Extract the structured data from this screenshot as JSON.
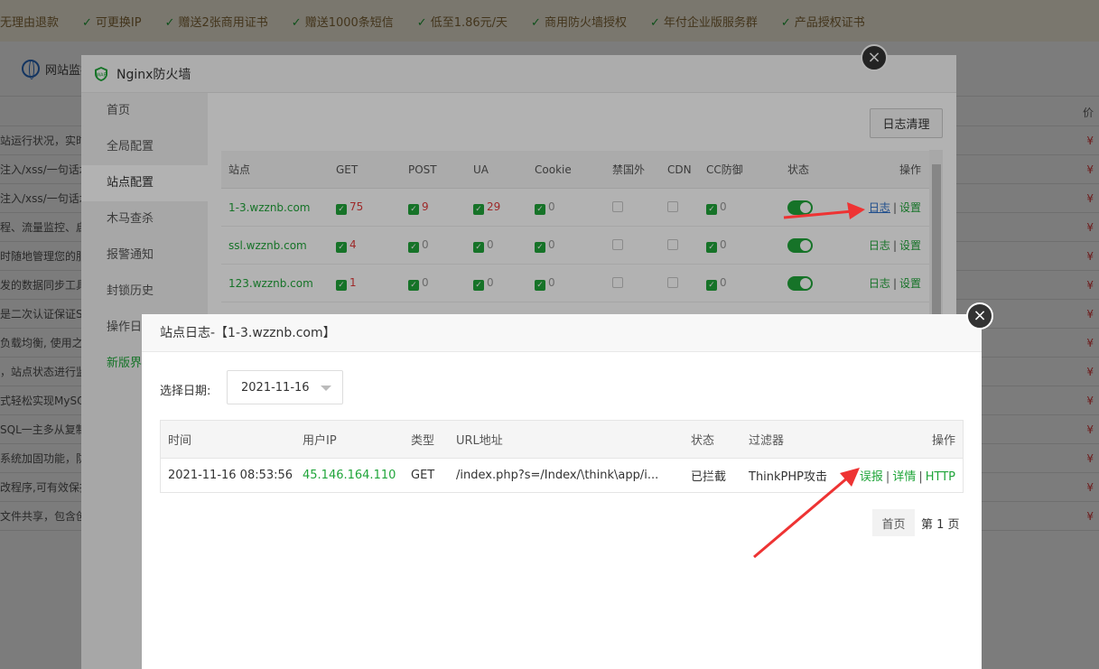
{
  "topbar": {
    "features": [
      "无理由退款",
      "可更换IP",
      "赠送2张商用证书",
      "赠送1000条短信",
      "低至1.86元/天",
      "商用防火墙授权",
      "年付企业版服务群",
      "产品授权证书"
    ]
  },
  "background": {
    "site_bar_label": "网站监控",
    "price_header": "价",
    "rows": [
      "站运行状况，实时",
      "注入/xss/一句话木",
      "注入/xss/一句话木",
      "程、流量监控、启",
      "时随地管理您的服",
      "发的数据同步工具",
      "是二次认证保证SS",
      "负载均衡, 使用之",
      "，站点状态进行监",
      "式轻松实现MySQ",
      "SQL一主多从复制",
      "系统加固功能，防",
      "改程序,可有效保护",
      "文件共享，包含创"
    ],
    "price_symbol": "¥"
  },
  "firewall": {
    "title": "Nginx防火墙",
    "close": "×",
    "menu": [
      "首页",
      "全局配置",
      "站点配置",
      "木马查杀",
      "报警通知",
      "封锁历史",
      "操作日",
      "新版界"
    ],
    "clear_log_button": "日志清理",
    "columns": [
      "站点",
      "GET",
      "POST",
      "UA",
      "Cookie",
      "禁国外",
      "CDN",
      "CC防御",
      "状态",
      "操作"
    ],
    "rows": [
      {
        "site": "1-3.wzznb.com",
        "get": "75",
        "post": "9",
        "ua": "29",
        "cookie": "0",
        "cc": "0",
        "op_log": "日志",
        "op_sep": "|",
        "op_set": "设置"
      },
      {
        "site": "ssl.wzznb.com",
        "get": "4",
        "post": "0",
        "ua": "0",
        "cookie": "0",
        "cc": "0",
        "op_log": "日志",
        "op_sep": "|",
        "op_set": "设置"
      },
      {
        "site": "123.wzznb.com",
        "get": "1",
        "post": "0",
        "ua": "0",
        "cookie": "0",
        "cc": "0",
        "op_log": "日志",
        "op_sep": "|",
        "op_set": "设置"
      }
    ]
  },
  "log_modal": {
    "title": "站点日志-【1-3.wzznb.com】",
    "close": "×",
    "date_label": "选择日期:",
    "date_value": "2021-11-16",
    "columns": [
      "时间",
      "用户IP",
      "类型",
      "URL地址",
      "状态",
      "过滤器",
      "操作"
    ],
    "rows": [
      {
        "time": "2021-11-16 08:53:56",
        "ip": "45.146.164.110",
        "type": "GET",
        "url": "/index.php?s=/Index/\\think\\app/i...",
        "state": "已拦截",
        "filter": "ThinkPHP攻击",
        "op_report": "误报",
        "op_sep1": "|",
        "op_detail": "详情",
        "op_sep2": "|",
        "op_http": "HTTP"
      }
    ],
    "pager": {
      "first": "首页",
      "current": "第 1 页"
    }
  },
  "colors": {
    "accent": "#20a53a",
    "danger": "#e23b3b",
    "annotation": "#ee3333"
  }
}
